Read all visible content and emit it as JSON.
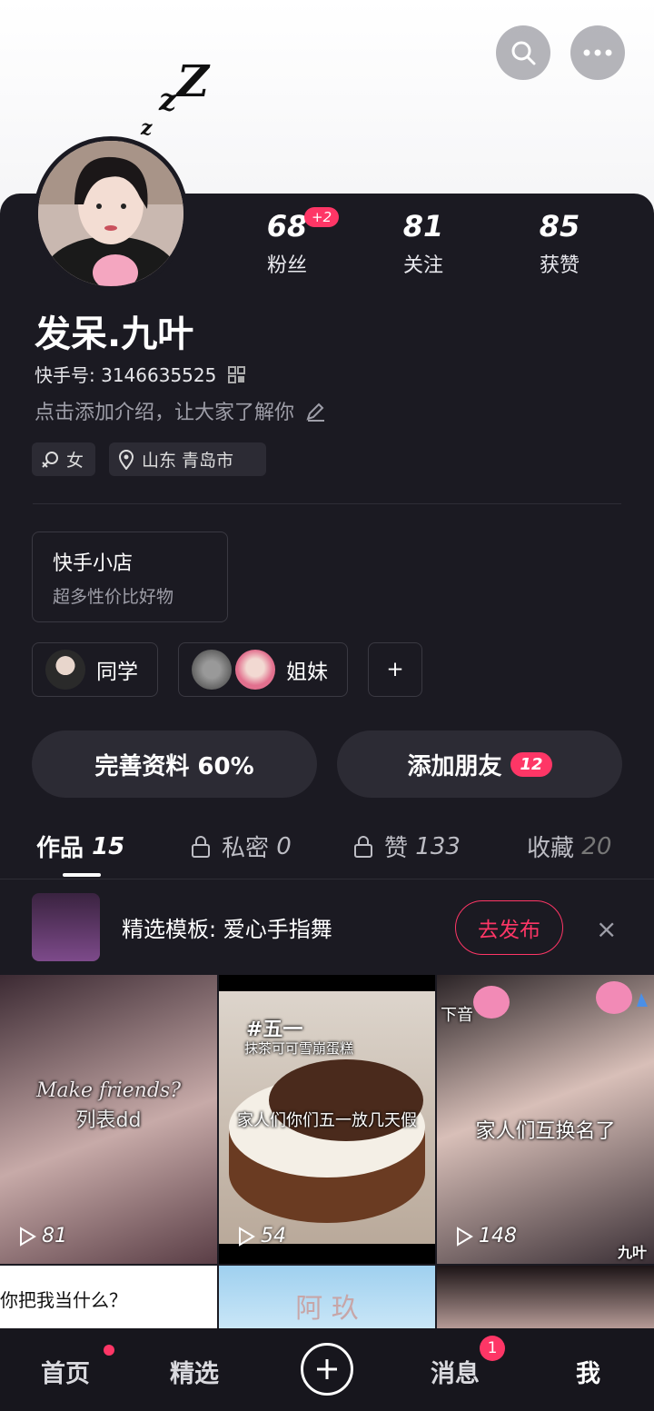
{
  "header": {
    "zzz": [
      "z",
      "z",
      "Z"
    ]
  },
  "stats": [
    {
      "value": "68",
      "label": "粉丝",
      "badge": "+2"
    },
    {
      "value": "81",
      "label": "关注"
    },
    {
      "value": "85",
      "label": "获赞"
    }
  ],
  "profile": {
    "name": "发呆.九叶",
    "kuaishou_id": "快手号: 3146635525",
    "intro": "点击添加介绍，让大家了解你",
    "gender": "女",
    "location": "山东 青岛市"
  },
  "shop": {
    "title": "快手小店",
    "subtitle": "超多性价比好物"
  },
  "groups": [
    {
      "label": "同学"
    },
    {
      "label": "姐妹"
    }
  ],
  "add_group": "+",
  "actions": {
    "complete": "完善资料 60%",
    "add_friend": "添加朋友",
    "add_friend_badge": "12"
  },
  "tabs": [
    {
      "label": "作品",
      "count": "15"
    },
    {
      "label": "私密",
      "count": "0"
    },
    {
      "label": "赞",
      "count": "133"
    },
    {
      "label": "收藏",
      "count": "20"
    }
  ],
  "banner": {
    "text": "精选模板: 爱心手指舞",
    "button": "去发布",
    "close": "×"
  },
  "grid": [
    {
      "caption_en": "Make friends?",
      "caption": "列表dd",
      "plays": "81"
    },
    {
      "tag": "#五一",
      "subtitle": "抹茶可可雪崩蛋糕",
      "caption": "家人们你们五一放几天假",
      "plays": "54"
    },
    {
      "tag": "下音",
      "caption": "家人们互换名了",
      "plays": "148",
      "watermark": "九叶"
    },
    {
      "caption": "你把我当什么？"
    },
    {
      "caption": "阿 玖"
    },
    {}
  ],
  "nav": {
    "items": [
      {
        "label": "首页"
      },
      {
        "label": "精选"
      },
      {
        "label": "消息",
        "badge": "1"
      },
      {
        "label": "我"
      }
    ]
  },
  "colors": {
    "accent": "#fe3666",
    "background": "#1b1a22"
  }
}
